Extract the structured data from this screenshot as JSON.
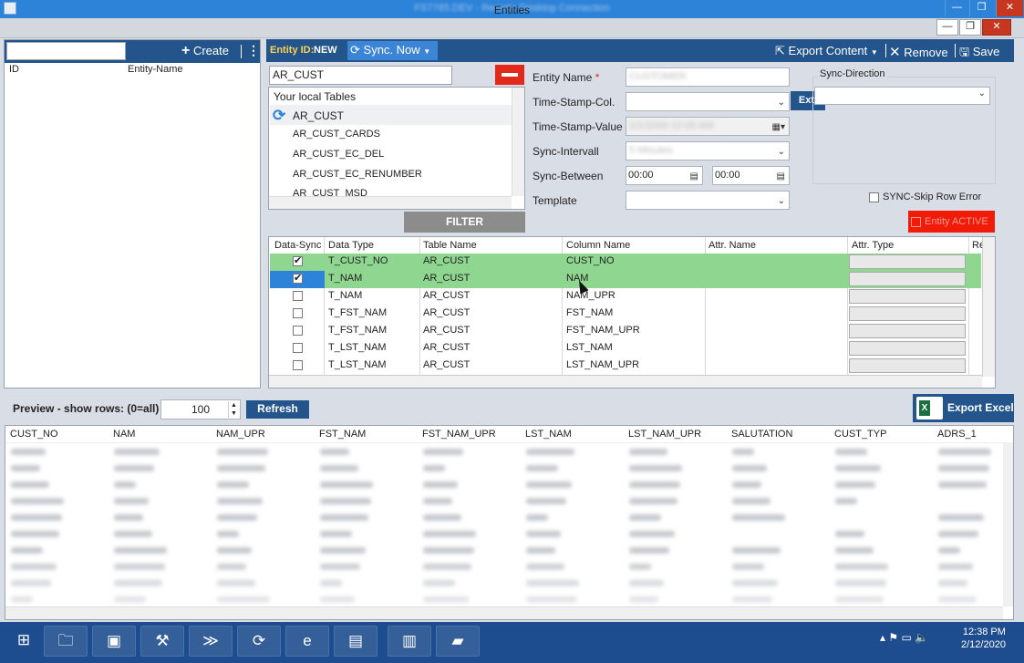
{
  "window": {
    "remote_title": "FS7785.DEV - Remote Desktop Connection",
    "app_title": "Entities",
    "minimize": "—",
    "restore": "❐",
    "close": "✕"
  },
  "left_panel": {
    "search_value": "",
    "create_label": "Create",
    "more_icon": "⋮",
    "columns": [
      "ID",
      "Entity-Name"
    ]
  },
  "toolbar": {
    "entity_id_label": "Entity ID:",
    "entity_id_value": "NEW",
    "sync_now": "Sync. Now",
    "export_content": "Export Content",
    "remove": "Remove",
    "save": "Save"
  },
  "tables": {
    "search_value": "AR_CUST",
    "header": "Your local Tables",
    "items": [
      "AR_CUST",
      "AR_CUST_CARDS",
      "AR_CUST_EC_DEL",
      "AR_CUST_EC_RENUMBER",
      "AR_CUST_MSD"
    ],
    "filter_label": "FILTER"
  },
  "form": {
    "entity_name_label": "Entity Name",
    "required_mark": "*",
    "entity_name_value": "CUSTOMER",
    "timestamp_col_label": "Time-Stamp-Col.",
    "timestamp_value_label": "Time-Stamp-Value",
    "timestamp_value": "1/1/2000 12:00 AM",
    "sync_interval_label": "Sync-Intervall",
    "sync_interval_value": "5 Minutes",
    "sync_between_label": "Sync-Between",
    "sync_between_from": "00:00",
    "sync_between_to": "00:00",
    "template_label": "Template",
    "ext_label": "Ext.",
    "sync_direction_label": "Sync-Direction",
    "skip_row_error_label": "SYNC-Skip Row Error",
    "entity_active_label": "Entity ACTIVE"
  },
  "grid": {
    "columns": [
      "Data-Sync",
      "Data Type",
      "Table Name",
      "Column Name",
      "Attr. Name",
      "Attr. Type",
      "Re"
    ],
    "rows": [
      {
        "checked": "✔",
        "data_type": "T_CUST_NO",
        "table": "AR_CUST",
        "column": "CUST_NO"
      },
      {
        "checked": "✔",
        "data_type": "T_NAM",
        "table": "AR_CUST",
        "column": "NAM"
      },
      {
        "checked": "",
        "data_type": "T_NAM",
        "table": "AR_CUST",
        "column": "NAM_UPR"
      },
      {
        "checked": "",
        "data_type": "T_FST_NAM",
        "table": "AR_CUST",
        "column": "FST_NAM"
      },
      {
        "checked": "",
        "data_type": "T_FST_NAM",
        "table": "AR_CUST",
        "column": "FST_NAM_UPR"
      },
      {
        "checked": "",
        "data_type": "T_LST_NAM",
        "table": "AR_CUST",
        "column": "LST_NAM"
      },
      {
        "checked": "",
        "data_type": "T_LST_NAM",
        "table": "AR_CUST",
        "column": "LST_NAM_UPR"
      }
    ]
  },
  "preview": {
    "label": "Preview - show rows: (0=all)",
    "rows_value": "100",
    "refresh_label": "Refresh",
    "export_excel_label": "Export Excel",
    "excel_letter": "X",
    "columns": [
      "CUST_NO",
      "NAM",
      "NAM_UPR",
      "FST_NAM",
      "FST_NAM_UPR",
      "LST_NAM",
      "LST_NAM_UPR",
      "SALUTATION",
      "CUST_TYP",
      "ADRS_1"
    ]
  },
  "taskbar": {
    "time": "12:38 PM",
    "date": "2/12/2020"
  },
  "colors": {
    "toolbar_blue": "#23548c",
    "row_green": "#8fd790",
    "alert_red": "#e32a1a"
  }
}
